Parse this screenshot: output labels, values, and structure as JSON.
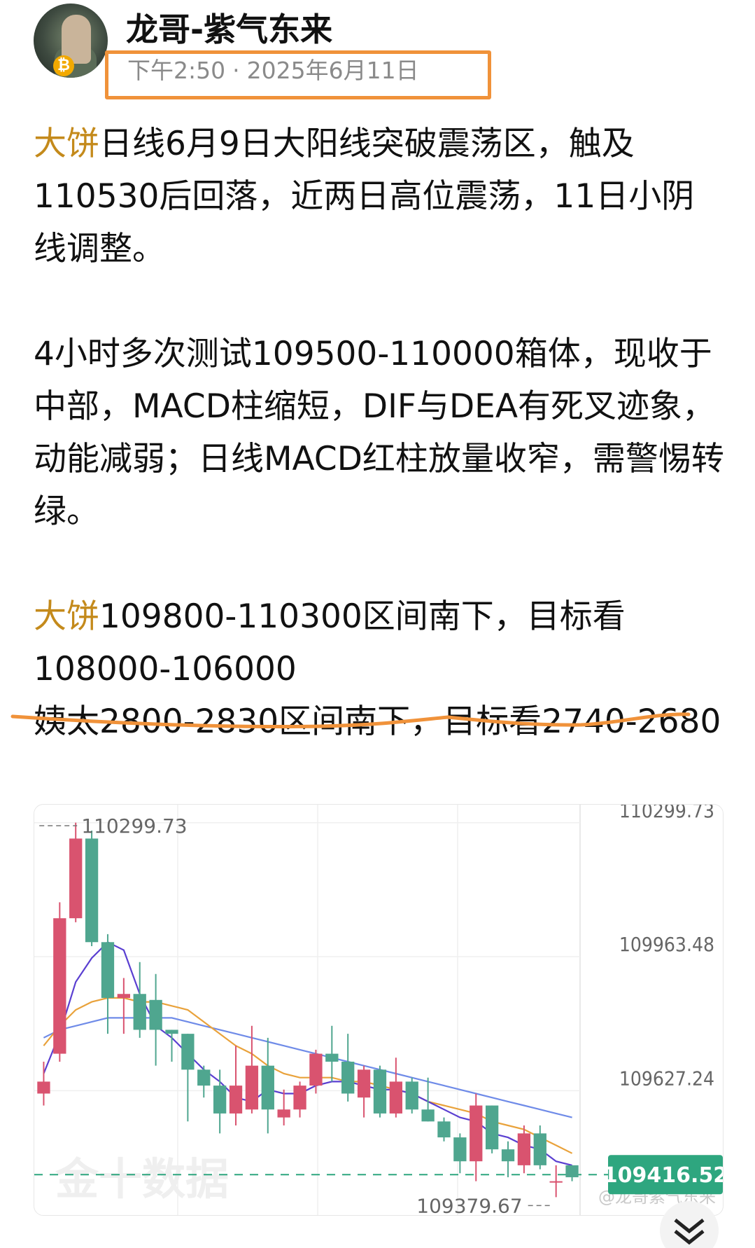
{
  "author": {
    "name": "龙哥-紫气东来",
    "time": "下午2:50",
    "date_sep": "·",
    "date": "2025年6月11日"
  },
  "post": {
    "p1_brand": "大饼",
    "p1_text": "日线6月9日大阳线突破震荡区，触及110530后回落，近两日高位震荡，11日小阴线调整。",
    "p2_text": "4小时多次测试109500-110000箱体，现收于中部，MACD柱缩短，DIF与DEA有死叉迹象，动能减弱；日线MACD红柱放量收窄，需警惕转绿。",
    "p3_brand": "大饼",
    "p3_text": "109800-110300区间南下，目标看108000-106000",
    "p4_text": "姨太2800-2830区间南下，目标看2740-2680"
  },
  "colors": {
    "brand": "#c48a1b",
    "annotation": "#f0923a",
    "bull": "#d9536f",
    "bear": "#4fa68f",
    "ma_purple": "#5a3fd1",
    "ma_orange": "#e9a23b",
    "ma_blue": "#6f8be8",
    "current_price_bg": "#2ea67f"
  },
  "chart_data": {
    "type": "candlestick",
    "y_axis_labels": [
      "110299.73",
      "109963.48",
      "109627.24"
    ],
    "max_label": "110299.73",
    "min_label": "109379.67",
    "current_price": "109416.52",
    "watermark": "金十数据",
    "source_watermark": "@龙哥紫气东来",
    "ylim": [
      109315,
      110345
    ],
    "candles": [
      {
        "o": 109620,
        "c": 109650,
        "h": 109700,
        "l": 109590
      },
      {
        "o": 109720,
        "c": 110060,
        "h": 110100,
        "l": 109700
      },
      {
        "o": 110060,
        "c": 110260,
        "h": 110300,
        "l": 110050
      },
      {
        "o": 110260,
        "c": 110000,
        "h": 110280,
        "l": 109990
      },
      {
        "o": 110000,
        "c": 109860,
        "h": 110020,
        "l": 109770
      },
      {
        "o": 109860,
        "c": 109870,
        "h": 109910,
        "l": 109770
      },
      {
        "o": 109870,
        "c": 109780,
        "h": 109950,
        "l": 109760
      },
      {
        "o": 109855,
        "c": 109780,
        "h": 109920,
        "l": 109690
      },
      {
        "o": 109780,
        "c": 109770,
        "h": 109780,
        "l": 109700
      },
      {
        "o": 109770,
        "c": 109680,
        "h": 109770,
        "l": 109550
      },
      {
        "o": 109680,
        "c": 109640,
        "h": 109690,
        "l": 109610
      },
      {
        "o": 109640,
        "c": 109570,
        "h": 109680,
        "l": 109520
      },
      {
        "o": 109570,
        "c": 109640,
        "h": 109740,
        "l": 109540
      },
      {
        "o": 109580,
        "c": 109690,
        "h": 109790,
        "l": 109570
      },
      {
        "o": 109690,
        "c": 109580,
        "h": 109760,
        "l": 109520
      },
      {
        "o": 109560,
        "c": 109580,
        "h": 109630,
        "l": 109540
      },
      {
        "o": 109580,
        "c": 109640,
        "h": 109650,
        "l": 109560
      },
      {
        "o": 109640,
        "c": 109720,
        "h": 109730,
        "l": 109620
      },
      {
        "o": 109720,
        "c": 109700,
        "h": 109790,
        "l": 109650
      },
      {
        "o": 109700,
        "c": 109620,
        "h": 109770,
        "l": 109600
      },
      {
        "o": 109610,
        "c": 109680,
        "h": 109690,
        "l": 109560
      },
      {
        "o": 109680,
        "c": 109570,
        "h": 109690,
        "l": 109560
      },
      {
        "o": 109570,
        "c": 109650,
        "h": 109710,
        "l": 109560
      },
      {
        "o": 109650,
        "c": 109580,
        "h": 109660,
        "l": 109570
      },
      {
        "o": 109580,
        "c": 109550,
        "h": 109660,
        "l": 109550
      },
      {
        "o": 109550,
        "c": 109510,
        "h": 109560,
        "l": 109500
      },
      {
        "o": 109510,
        "c": 109450,
        "h": 109520,
        "l": 109420
      },
      {
        "o": 109450,
        "c": 109590,
        "h": 109620,
        "l": 109400
      },
      {
        "o": 109590,
        "c": 109480,
        "h": 109590,
        "l": 109470
      },
      {
        "o": 109480,
        "c": 109450,
        "h": 109500,
        "l": 109410
      },
      {
        "o": 109440,
        "c": 109520,
        "h": 109540,
        "l": 109420
      },
      {
        "o": 109520,
        "c": 109440,
        "h": 109540,
        "l": 109430
      },
      {
        "o": 109400,
        "c": 109400,
        "h": 109440,
        "l": 109360
      },
      {
        "o": 109440,
        "c": 109410,
        "h": 109440,
        "l": 109400
      }
    ],
    "ma_purple": [
      109670,
      109770,
      109900,
      109960,
      110000,
      109980,
      109870,
      109790,
      109760,
      109720,
      109680,
      109650,
      109610,
      109600,
      109630,
      109620,
      109620,
      109640,
      109650,
      109650,
      109640,
      109630,
      109630,
      109620,
      109600,
      109580,
      109560,
      109550,
      109520,
      109510,
      109490,
      109480,
      109450,
      109440
    ],
    "ma_orange": [
      109740,
      109790,
      109830,
      109850,
      109860,
      109860,
      109850,
      109850,
      109840,
      109830,
      109800,
      109770,
      109740,
      109720,
      109690,
      109670,
      109660,
      109660,
      109660,
      109650,
      109650,
      109640,
      109630,
      109620,
      109600,
      109590,
      109580,
      109570,
      109550,
      109540,
      109530,
      109510,
      109490,
      109470
    ],
    "ma_blue": [
      109760,
      109780,
      109790,
      109800,
      109810,
      109810,
      109810,
      109810,
      109810,
      109800,
      109790,
      109780,
      109770,
      109760,
      109750,
      109740,
      109730,
      109720,
      109710,
      109700,
      109690,
      109680,
      109670,
      109660,
      109650,
      109640,
      109630,
      109620,
      109610,
      109600,
      109590,
      109580,
      109570,
      109560
    ]
  }
}
